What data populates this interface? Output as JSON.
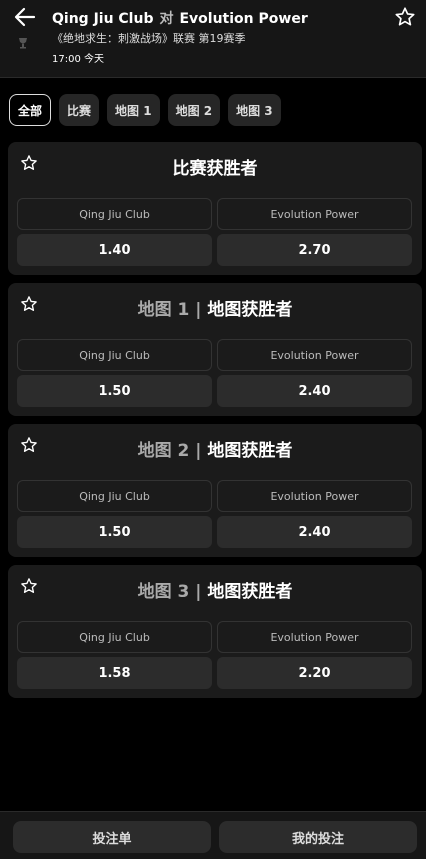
{
  "header": {
    "team_home": "Qing Jiu Club",
    "vs": "对",
    "team_away": "Evolution Power",
    "league": "《绝地求生：刺激战场》联赛 第19赛季",
    "time": "17:00 今天"
  },
  "tabs": [
    {
      "label": "全部",
      "active": true
    },
    {
      "label": "比赛",
      "active": false
    },
    {
      "label": "地图 1",
      "active": false
    },
    {
      "label": "地图 2",
      "active": false
    },
    {
      "label": "地图 3",
      "active": false
    }
  ],
  "markets": [
    {
      "prefix": "",
      "title": "比赛获胜者",
      "home": "Qing Jiu Club",
      "away": "Evolution Power",
      "home_odd": "1.40",
      "away_odd": "2.70"
    },
    {
      "prefix": "地图 1 | ",
      "title": "地图获胜者",
      "home": "Qing Jiu Club",
      "away": "Evolution Power",
      "home_odd": "1.50",
      "away_odd": "2.40"
    },
    {
      "prefix": "地图 2 | ",
      "title": "地图获胜者",
      "home": "Qing Jiu Club",
      "away": "Evolution Power",
      "home_odd": "1.50",
      "away_odd": "2.40"
    },
    {
      "prefix": "地图 3 | ",
      "title": "地图获胜者",
      "home": "Qing Jiu Club",
      "away": "Evolution Power",
      "home_odd": "1.58",
      "away_odd": "2.20"
    }
  ],
  "footer": {
    "betslip": "投注单",
    "my_bets": "我的投注"
  },
  "icons": {
    "back": "arrow-left-icon",
    "favorite": "star-outline-icon",
    "league": "league-logo-icon"
  }
}
